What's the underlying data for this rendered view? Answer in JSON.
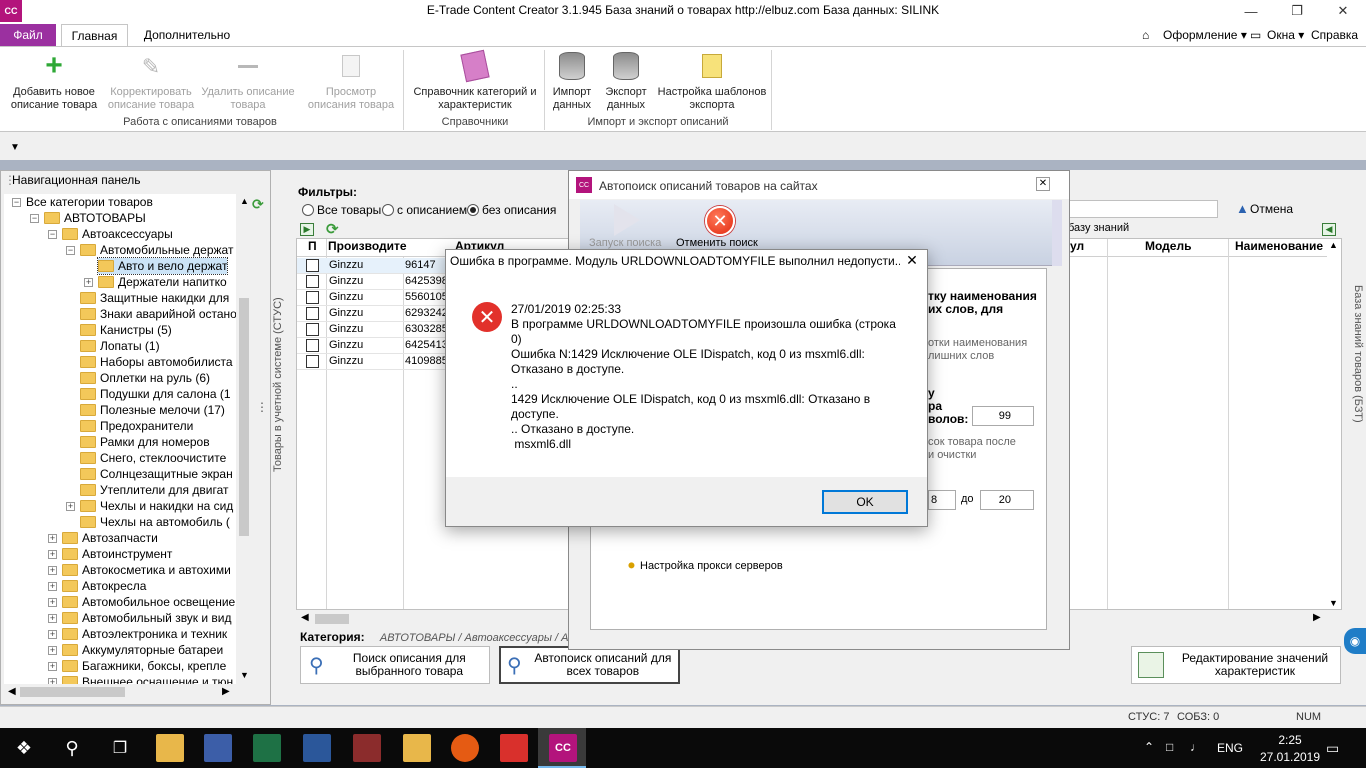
{
  "window": {
    "app_icon": "CC",
    "title": "E-Trade Content Creator 3.1.945     База знаний о товарах     http://elbuz.com     База данных: SILINK"
  },
  "ribbon": {
    "tabs": [
      "Файл",
      "Главная",
      "Дополнительно"
    ],
    "right_menu": [
      "Оформление ▾",
      "Окна ▾",
      "Справка ▾"
    ],
    "buttons": {
      "add": "Добавить новое описание товара",
      "edit": "Корректировать описание товара",
      "delete": "Удалить описание товара",
      "view": "Просмотр описания товара",
      "catalog": "Справочник категорий и характеристик",
      "import": "Импорт данных",
      "export": "Экспорт данных",
      "templates": "Настройка шаблонов экспорта"
    },
    "groups": [
      "Работа с описаниями товаров",
      "Справочники",
      "Импорт и экспорт описаний"
    ]
  },
  "nav": {
    "title": "Навигационная панель",
    "tree": [
      {
        "label": "Все категории товаров",
        "level": 0,
        "exp": "-"
      },
      {
        "label": "АВТОТОВАРЫ",
        "level": 1,
        "exp": "-"
      },
      {
        "label": "Автоаксессуары",
        "level": 2,
        "exp": "-"
      },
      {
        "label": "Автомобильные держат",
        "level": 3,
        "exp": "-"
      },
      {
        "label": "Авто и вело держат",
        "level": 4,
        "exp": ""
      },
      {
        "label": "Держатели напитко",
        "level": 4,
        "exp": "+"
      },
      {
        "label": "Защитные накидки для",
        "level": 3,
        "exp": ""
      },
      {
        "label": "Знаки аварийной остано",
        "level": 3,
        "exp": ""
      },
      {
        "label": "Канистры (5)",
        "level": 3,
        "exp": ""
      },
      {
        "label": "Лопаты (1)",
        "level": 3,
        "exp": ""
      },
      {
        "label": "Наборы автомобилиста",
        "level": 3,
        "exp": ""
      },
      {
        "label": "Оплетки на руль (6)",
        "level": 3,
        "exp": ""
      },
      {
        "label": "Подушки для салона (1",
        "level": 3,
        "exp": ""
      },
      {
        "label": "Полезные мелочи (17)",
        "level": 3,
        "exp": ""
      },
      {
        "label": "Предохранители",
        "level": 3,
        "exp": ""
      },
      {
        "label": "Рамки для номеров",
        "level": 3,
        "exp": ""
      },
      {
        "label": "Снего, стеклоочистите",
        "level": 3,
        "exp": ""
      },
      {
        "label": "Солнцезащитные экран",
        "level": 3,
        "exp": ""
      },
      {
        "label": "Утеплители для двигат",
        "level": 3,
        "exp": ""
      },
      {
        "label": "Чехлы и накидки на сид",
        "level": 3,
        "exp": "+"
      },
      {
        "label": "Чехлы на автомобиль (",
        "level": 3,
        "exp": ""
      },
      {
        "label": "Автозапчасти",
        "level": 2,
        "exp": "+"
      },
      {
        "label": "Автоинструмент",
        "level": 2,
        "exp": "+"
      },
      {
        "label": "Автокосметика и автохими",
        "level": 2,
        "exp": "+"
      },
      {
        "label": "Автокресла",
        "level": 2,
        "exp": "+"
      },
      {
        "label": "Автомобильное освещение",
        "level": 2,
        "exp": "+"
      },
      {
        "label": "Автомобильный звук и вид",
        "level": 2,
        "exp": "+"
      },
      {
        "label": "Автоэлектроника и техник",
        "level": 2,
        "exp": "+"
      },
      {
        "label": "Аккумуляторные батареи",
        "level": 2,
        "exp": "+"
      },
      {
        "label": "Багажники, боксы, крепле",
        "level": 2,
        "exp": "+"
      },
      {
        "label": "Внешнее оснащение и тюн",
        "level": 2,
        "exp": "+"
      }
    ]
  },
  "center": {
    "side_left": "Товары в учетной системе (СТУС)",
    "side_right": "База знаний товаров (БЗТ)",
    "filters_label": "Фильтры:",
    "filters": [
      "Все товары",
      "с описанием",
      "без описания"
    ],
    "columns": [
      "П",
      "Производите",
      "Артикул"
    ],
    "right_columns": [
      "ул",
      "Модель",
      "Наименование"
    ],
    "rows": [
      {
        "maker": "Ginzzu",
        "sku": "96147"
      },
      {
        "maker": "Ginzzu",
        "sku": "6425398"
      },
      {
        "maker": "Ginzzu",
        "sku": "5560105"
      },
      {
        "maker": "Ginzzu",
        "sku": "6293242"
      },
      {
        "maker": "Ginzzu",
        "sku": "6303285"
      },
      {
        "maker": "Ginzzu",
        "sku": "6425413"
      },
      {
        "maker": "Ginzzu",
        "sku": "4109885"
      }
    ],
    "kb_hint": "базу знаний",
    "cancel": "Отмена",
    "category_label": "Категория:",
    "category_path": "АВТОТОВАРЫ / Автоаксессуары / Ав",
    "btn_search": "Поиск описания для выбранного товара",
    "btn_autosearch": "Автопоиск описаний для всех товаров",
    "btn_edit_values": "Редактирование значений характеристик"
  },
  "autosearch": {
    "title": "Автопоиск описаний товаров на сайтах",
    "start": "Запуск поиска",
    "cancel": "Отменить поиск",
    "heading": "тку наименования\nих слов, для",
    "note1": "отки наименования\nлишних слов",
    "label_a": "у\nра\nволов:",
    "spin_a": "99",
    "note2": "сок товара после\nи очистки",
    "spin_from": "8",
    "to": "до",
    "spin_to": "20",
    "proxy": "Настройка прокси серверов"
  },
  "error": {
    "title": "Ошибка в программе. Модуль URLDOWNLOADTOMYFILE выполнил недопусти...",
    "lines": [
      "27/01/2019 02:25:33",
      "В программе URLDOWNLOADTOMYFILE произошла ошибка (строка",
      "0)",
      "Ошибка N:1429 Исключение OLE IDispatch, код 0 из msxml6.dll:",
      "Отказано в доступе.",
      "..",
      "1429 Исключение OLE IDispatch, код 0 из msxml6.dll: Отказано в",
      "доступе.",
      ".. Отказано в доступе.",
      " msxml6.dll"
    ],
    "ok": "OK"
  },
  "status": {
    "stus": "СТУС: 7",
    "sobz": "СОБЗ: 0",
    "num": "NUM"
  },
  "taskbar": {
    "lang": "ENG",
    "time": "2:25",
    "date": "27.01.2019",
    "active_app": "CC"
  },
  "colors": {
    "accent": "#9b30a0",
    "error": "#e2312b",
    "focus": "#0078d7"
  }
}
